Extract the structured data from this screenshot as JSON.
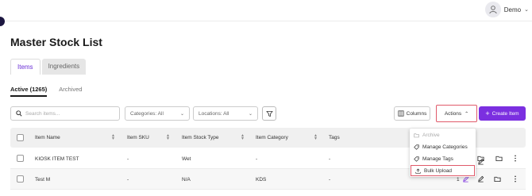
{
  "user": {
    "name": "Demo"
  },
  "page": {
    "title": "Master Stock List"
  },
  "tabs": [
    {
      "label": "Items"
    },
    {
      "label": "Ingredients"
    }
  ],
  "subtabs": [
    {
      "label": "Active (1265)"
    },
    {
      "label": "Archived"
    }
  ],
  "search": {
    "placeholder": "Search items..."
  },
  "filters": {
    "categories": "Categories: All",
    "locations": "Locations: All"
  },
  "toolbar": {
    "columns_label": "Columns",
    "actions_label": "Actions",
    "create_label": "Create Item"
  },
  "table": {
    "headers": [
      "Item Name",
      "Item SKU",
      "Item Stock Type",
      "Item Category",
      "Tags"
    ],
    "rows": [
      {
        "name": "KIOSK ITEM TEST",
        "sku": "-",
        "stock_type": "Wet",
        "category": "-",
        "tags": "-"
      },
      {
        "name": "Test M",
        "sku": "-",
        "stock_type": "N/A",
        "category": "KDS",
        "tags": "-",
        "partial": "1"
      }
    ]
  },
  "actions_menu": [
    {
      "label": "Archive",
      "disabled": true,
      "icon": "archive-icon"
    },
    {
      "label": "Manage Categories",
      "icon": "tag-icon"
    },
    {
      "label": "Manage Tags",
      "icon": "tag-icon"
    },
    {
      "label": "Bulk Upload",
      "icon": "upload-icon",
      "highlighted": true
    }
  ],
  "colors": {
    "accent": "#7b2fe0",
    "highlight": "#e05a6a",
    "sidebar_dot": "#1c1640"
  }
}
